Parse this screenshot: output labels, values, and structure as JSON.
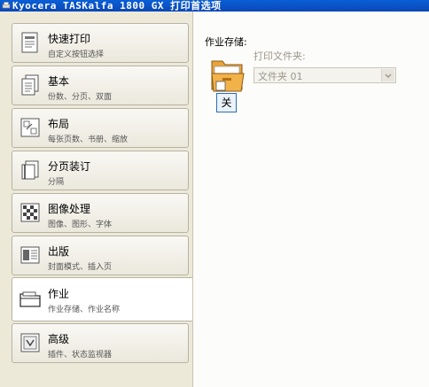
{
  "window": {
    "title": "Kyocera TASKalfa 1800 GX 打印首选项"
  },
  "sidebar": {
    "items": [
      {
        "label": "快速打印",
        "desc": "自定义按钮选择",
        "icon": "quick-print-icon",
        "active": false
      },
      {
        "label": "基本",
        "desc": "份数、分页、双面",
        "icon": "basic-icon",
        "active": false
      },
      {
        "label": "布局",
        "desc": "每张页数、书册、缩放",
        "icon": "layout-icon",
        "active": false
      },
      {
        "label": "分页装订",
        "desc": "分隔",
        "icon": "finishing-icon",
        "active": false
      },
      {
        "label": "图像处理",
        "desc": "图像、图形、字体",
        "icon": "imaging-icon",
        "active": false
      },
      {
        "label": "出版",
        "desc": "封面模式、插入页",
        "icon": "publishing-icon",
        "active": false
      },
      {
        "label": "作业",
        "desc": "作业存储、作业名称",
        "icon": "job-icon",
        "active": true
      },
      {
        "label": "高级",
        "desc": "插件、状态监视器",
        "icon": "advanced-icon",
        "active": false
      }
    ]
  },
  "main": {
    "job_storage_label": "作业存储:",
    "job_storage_state": "关",
    "print_folder_label": "打印文件夹:",
    "folder_select_value": "文件夹 01"
  },
  "colors": {
    "titlebar": "#0b4fc4",
    "panel_bg": "#ece9d8",
    "content_bg": "#fcfcfa",
    "accent_border": "#2a6fb0"
  }
}
